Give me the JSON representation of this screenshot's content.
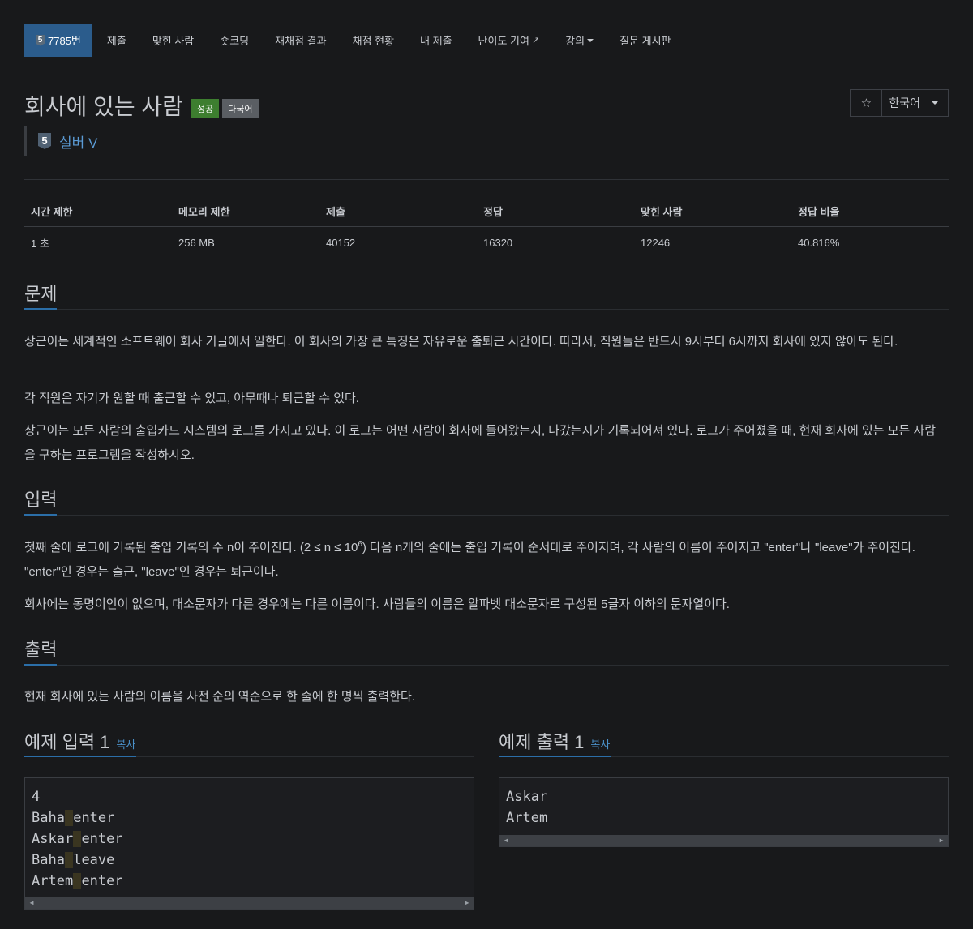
{
  "nav": {
    "problem_tier": "5",
    "problem_number": "7785번",
    "items": [
      "제출",
      "맞힌 사람",
      "숏코딩",
      "재채점 결과",
      "채점 현황",
      "내 제출",
      "난이도 기여",
      "강의",
      "질문 게시판"
    ]
  },
  "problem": {
    "title": "회사에 있는 사람",
    "badge_success": "성공",
    "badge_multi": "다국어",
    "tier_num": "5",
    "tier_name": "실버 V"
  },
  "toolbar": {
    "star_icon": "☆",
    "language": "한국어"
  },
  "info_table": {
    "headers": [
      "시간 제한",
      "메모리 제한",
      "제출",
      "정답",
      "맞힌 사람",
      "정답 비율"
    ],
    "values": [
      "1 초",
      "256 MB",
      "40152",
      "16320",
      "12246",
      "40.816%"
    ]
  },
  "sections": {
    "problem": {
      "title": "문제",
      "p1": "상근이는 세계적인 소프트웨어 회사 기글에서 일한다. 이 회사의 가장 큰 특징은 자유로운 출퇴근 시간이다. 따라서, 직원들은 반드시 9시부터 6시까지 회사에 있지 않아도 된다.",
      "p2": "각 직원은 자기가 원할 때 출근할 수 있고, 아무때나 퇴근할 수 있다.",
      "p3": "상근이는 모든 사람의 출입카드 시스템의 로그를 가지고 있다. 이 로그는 어떤 사람이 회사에 들어왔는지, 나갔는지가 기록되어져 있다. 로그가 주어졌을 때, 현재 회사에 있는 모든 사람을 구하는 프로그램을 작성하시오."
    },
    "input": {
      "title": "입력",
      "p1_before": "첫째 줄에 로그에 기록된 출입 기록의 수 n이 주어진다. (2 ≤ n ≤ 10",
      "p1_sup": "6",
      "p1_after": ") 다음 n개의 줄에는 출입 기록이 순서대로 주어지며, 각 사람의 이름이 주어지고 \"enter\"나 \"leave\"가 주어진다. \"enter\"인 경우는 출근, \"leave\"인 경우는 퇴근이다.",
      "p2": "회사에는 동명이인이 없으며, 대소문자가 다른 경우에는 다른 이름이다. 사람들의 이름은 알파벳 대소문자로 구성된 5글자 이하의 문자열이다."
    },
    "output": {
      "title": "출력",
      "p1": "현재 회사에 있는 사람의 이름을 사전 순의 역순으로 한 줄에 한 명씩 출력한다."
    }
  },
  "examples": {
    "copy_label": "복사",
    "input_title": "예제 입력 1",
    "output_title": "예제 출력 1",
    "input_first": "4",
    "input_rows": [
      {
        "name": "Baha",
        "action": "enter"
      },
      {
        "name": "Askar",
        "action": "enter"
      },
      {
        "name": "Baha",
        "action": "leave"
      },
      {
        "name": "Artem",
        "action": "enter"
      }
    ],
    "output_lines": [
      "Askar",
      "Artem"
    ]
  }
}
